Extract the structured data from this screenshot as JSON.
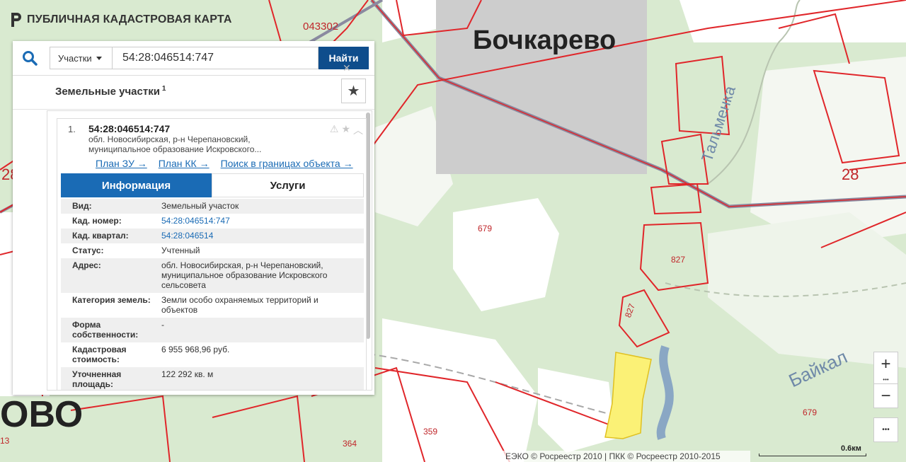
{
  "app": {
    "title": "ПУБЛИЧНАЯ КАДАСТРОВАЯ КАРТА"
  },
  "search": {
    "type_label": "Участки",
    "query": "54:28:046514:747",
    "button_label": "Найти",
    "close_glyph": "✕"
  },
  "results": {
    "title": "Земельные участки",
    "count": "1",
    "items": [
      {
        "index": "1.",
        "cadastral_number": "54:28:046514:747",
        "address_line1": "обл. Новосибирская, р-н Черепановский,",
        "address_line2": "муниципальное образование Искровского...",
        "links": [
          "План ЗУ →",
          "План КК →",
          "Поиск в границах объекта →"
        ]
      }
    ]
  },
  "tabs": {
    "info": "Информация",
    "services": "Услуги"
  },
  "details": [
    {
      "key": "Вид:",
      "value": "Земельный участок"
    },
    {
      "key": "Кад. номер:",
      "value": "54:28:046514:747"
    },
    {
      "key": "Кад. квартал:",
      "value": "54:28:046514"
    },
    {
      "key": "Статус:",
      "value": "Учтенный"
    },
    {
      "key": "Адрес:",
      "value": "обл. Новосибирская, р-н Черепановский, муниципальное образование Искровского сельсовета"
    },
    {
      "key": "Категория земель:",
      "value": "Земли особо охраняемых территорий и объектов"
    },
    {
      "key": "Форма собственности:",
      "value": "-"
    },
    {
      "key": "Кадастровая стоимость:",
      "value": "6 955 968,96 руб."
    },
    {
      "key": "Уточненная площадь:",
      "value": "122 292 кв. м"
    }
  ],
  "map": {
    "labels": {
      "village": "Бочкарево",
      "village_cut": "ово",
      "river1": "Тальменка",
      "river2": "Байкал",
      "quarter": "043302",
      "num28_left": "28",
      "num28_right": "28",
      "p679_a": "679",
      "p679_b": "679",
      "p827_a": "827",
      "p827_b": "827",
      "p359": "359",
      "p364": "364",
      "p13": "13"
    },
    "colors": {
      "parcel_border": "#e0262a",
      "highlight": "#fbf176",
      "forest": "#d7e9cc",
      "river": "#8aa7c4"
    }
  },
  "controls": {
    "zoom_in": "+",
    "zoom_out": "−",
    "dots": "•••"
  },
  "attribution": "ЕЭКО © Росреестр 2010 | ПКК © Росреестр 2010-2015",
  "scale": "0.6км"
}
